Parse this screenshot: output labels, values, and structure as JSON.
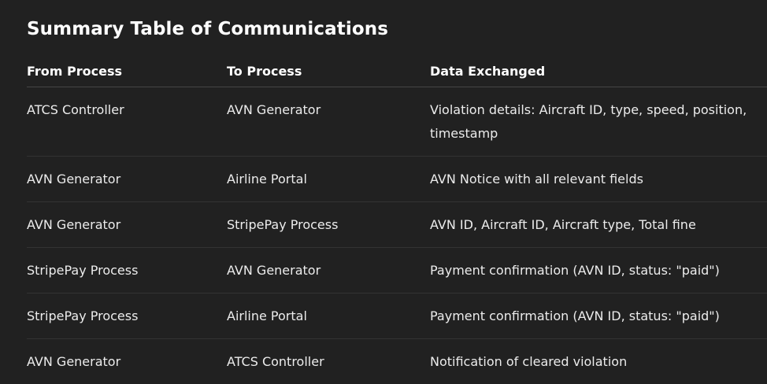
{
  "title": "Summary Table of Communications",
  "table": {
    "headers": [
      "From Process",
      "To Process",
      "Data Exchanged"
    ],
    "rows": [
      [
        "ATCS Controller",
        "AVN Generator",
        "Violation details: Aircraft ID, type, speed, position, timestamp"
      ],
      [
        "AVN Generator",
        "Airline Portal",
        "AVN Notice with all relevant fields"
      ],
      [
        "AVN Generator",
        "StripePay Process",
        "AVN ID, Aircraft ID, Aircraft type, Total fine"
      ],
      [
        "StripePay Process",
        "AVN Generator",
        "Payment confirmation (AVN ID, status: \"paid\")"
      ],
      [
        "StripePay Process",
        "Airline Portal",
        "Payment confirmation (AVN ID, status: \"paid\")"
      ],
      [
        "AVN Generator",
        "ATCS Controller",
        "Notification of cleared violation"
      ]
    ]
  }
}
